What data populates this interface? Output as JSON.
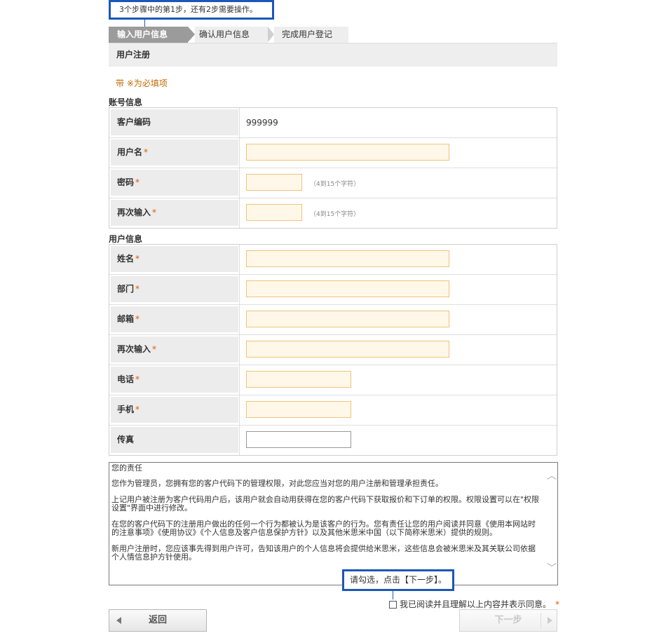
{
  "callout_top": "3个步骤中的第1步，还有2步需要操作。",
  "steps": [
    "输入用户信息",
    "确认用户信息",
    "完成用户登记"
  ],
  "section_header": "用户注册",
  "required_note": "带 ※为必填项",
  "account_section": {
    "title": "账号信息",
    "rows": {
      "customer_code": {
        "label": "客户编码",
        "value": "999999"
      },
      "username": {
        "label": "用户名",
        "req": "*"
      },
      "password": {
        "label": "密码",
        "req": "*",
        "hint": "（4到15个字符）"
      },
      "password_confirm": {
        "label": "再次输入",
        "req": "*",
        "hint": "（4到15个字符）"
      }
    }
  },
  "user_section": {
    "title": "用户信息",
    "rows": {
      "name": {
        "label": "姓名",
        "req": "*"
      },
      "department": {
        "label": "部门",
        "req": "*"
      },
      "email": {
        "label": "邮箱",
        "req": "*"
      },
      "email_confirm": {
        "label": "再次输入",
        "req": "*"
      },
      "phone": {
        "label": "电话",
        "req": "*"
      },
      "mobile": {
        "label": "手机",
        "req": "*"
      },
      "fax": {
        "label": "传真"
      }
    }
  },
  "terms": {
    "title": "您的责任",
    "p1": "您作为管理员，您拥有您的客户代码下的管理权限，对此您应当对您的用户注册和管理承担责任。",
    "p2": "上记用户被注册为客户代码用户后，该用户就会自动用获得在您的客户代码下获取报价和下订单的权限。权限设置可以在\"权限设置\"界面中进行修改。",
    "p3": "在您的客户代码下的注册用户做出的任何一个行为都被认为是该客户的行为。您有责任让您的用户阅读并同意《使用本网站时的注意事项》《使用协议》《个人信息及客户信息保护方针》以及其他米思米中国（以下简称米思米）提供的规则。",
    "p4": "新用户注册时，您应该事先得到用户许可，告知该用户的个人信息将会提供给米思米，这些信息会被米思米及其关联公司依据个人情信息护方针使用。"
  },
  "callout_bottom": "请勾选，点击【下一步】。",
  "agree_label": "我已阅读并且理解以上内容并表示同意。",
  "agree_req": "*",
  "buttons": {
    "back": "返回",
    "next": "下一步"
  }
}
